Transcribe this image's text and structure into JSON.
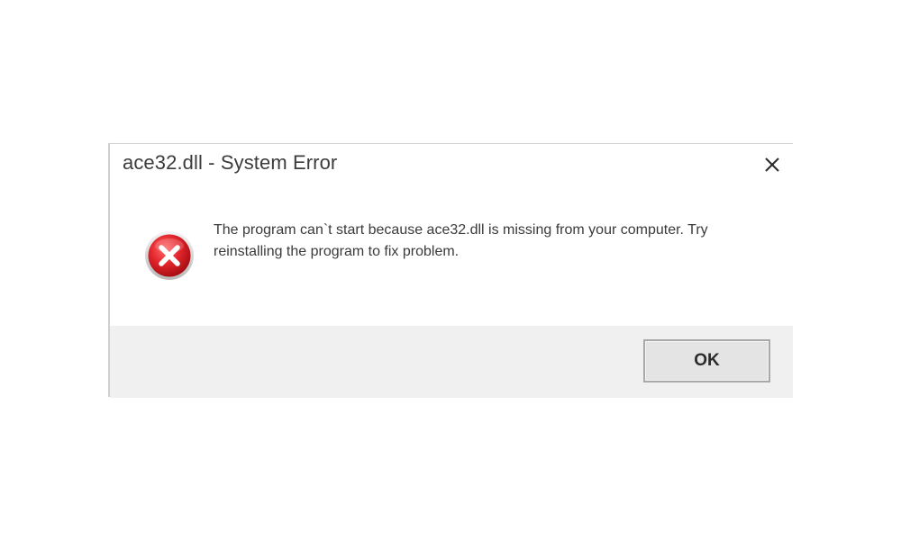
{
  "dialog": {
    "title": "ace32.dll - System Error",
    "icon": "error-icon",
    "message": "The program can`t start because ace32.dll is missing from your computer. Try reinstalling the program to fix problem.",
    "buttons": {
      "ok_label": "OK"
    },
    "close_icon": "close-icon"
  },
  "colors": {
    "footer_background": "#f0f0f0",
    "error_red": "#e2242b",
    "title_text": "#3c3c3c"
  }
}
